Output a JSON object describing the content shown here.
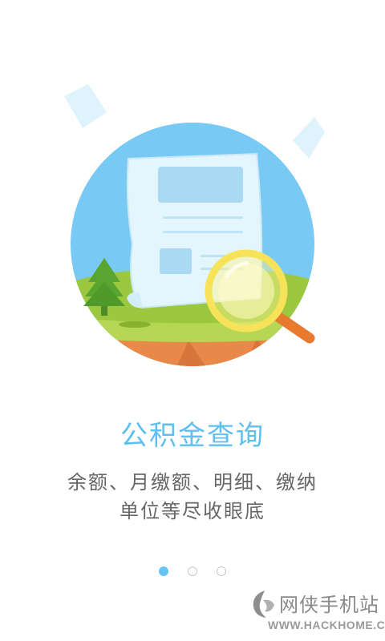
{
  "onboarding": {
    "title": "公积金查询",
    "description_lines": [
      "余额、月缴额、明细、缴纳",
      "单位等尽收眼底"
    ],
    "page_indicator": {
      "total": 3,
      "current": 1
    }
  },
  "illustration": {
    "icon": "document-magnifier-illustration"
  },
  "watermark": {
    "name": "网侠手机站",
    "url": "WWW.HACKHOME.COM"
  },
  "colors": {
    "accent": "#5fc0f0",
    "sky": "#78c9f3",
    "grass": "#9cc840",
    "soil": "#e8894a",
    "dot_active": "#66c3f2",
    "dot_inactive": "#c7c7c7",
    "text": "#666666"
  }
}
